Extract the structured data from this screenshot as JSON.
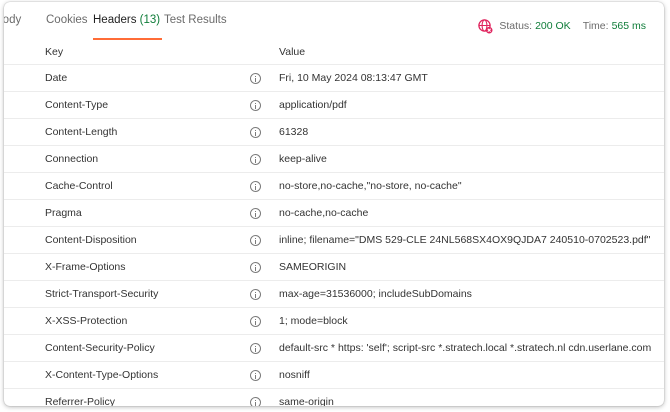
{
  "tabs": [
    {
      "label": "Body",
      "active": false
    },
    {
      "label": "Cookies",
      "active": false
    },
    {
      "label": "Headers",
      "count": "(13)",
      "active": true
    },
    {
      "label": "Test Results",
      "active": false
    }
  ],
  "status": {
    "icon": "globe-no-network-icon",
    "status_label": "Status:",
    "status_value": "200 OK",
    "time_label": "Time:",
    "time_value": "565 ms",
    "accent_color": "#0f7d39"
  },
  "table": {
    "columns": {
      "key": "Key",
      "value": "Value"
    },
    "rows": [
      {
        "key": "Date",
        "value": "Fri, 10 May 2024 08:13:47 GMT"
      },
      {
        "key": "Content-Type",
        "value": "application/pdf"
      },
      {
        "key": "Content-Length",
        "value": "61328"
      },
      {
        "key": "Connection",
        "value": "keep-alive"
      },
      {
        "key": "Cache-Control",
        "value": "no-store,no-cache,\"no-store, no-cache\""
      },
      {
        "key": "Pragma",
        "value": "no-cache,no-cache"
      },
      {
        "key": "Content-Disposition",
        "value": "inline; filename=\"DMS 529-CLE 24NL568SX4OX9QJDA7 240510-0702523.pdf\""
      },
      {
        "key": "X-Frame-Options",
        "value": "SAMEORIGIN"
      },
      {
        "key": "Strict-Transport-Security",
        "value": "max-age=31536000; includeSubDomains"
      },
      {
        "key": "X-XSS-Protection",
        "value": "1; mode=block"
      },
      {
        "key": "Content-Security-Policy",
        "value": "default-src * https: 'self'; script-src *.stratech.local *.stratech.nl cdn.userlane.com"
      },
      {
        "key": "X-Content-Type-Options",
        "value": "nosniff"
      },
      {
        "key": "Referrer-Policy",
        "value": "same-origin"
      }
    ]
  }
}
